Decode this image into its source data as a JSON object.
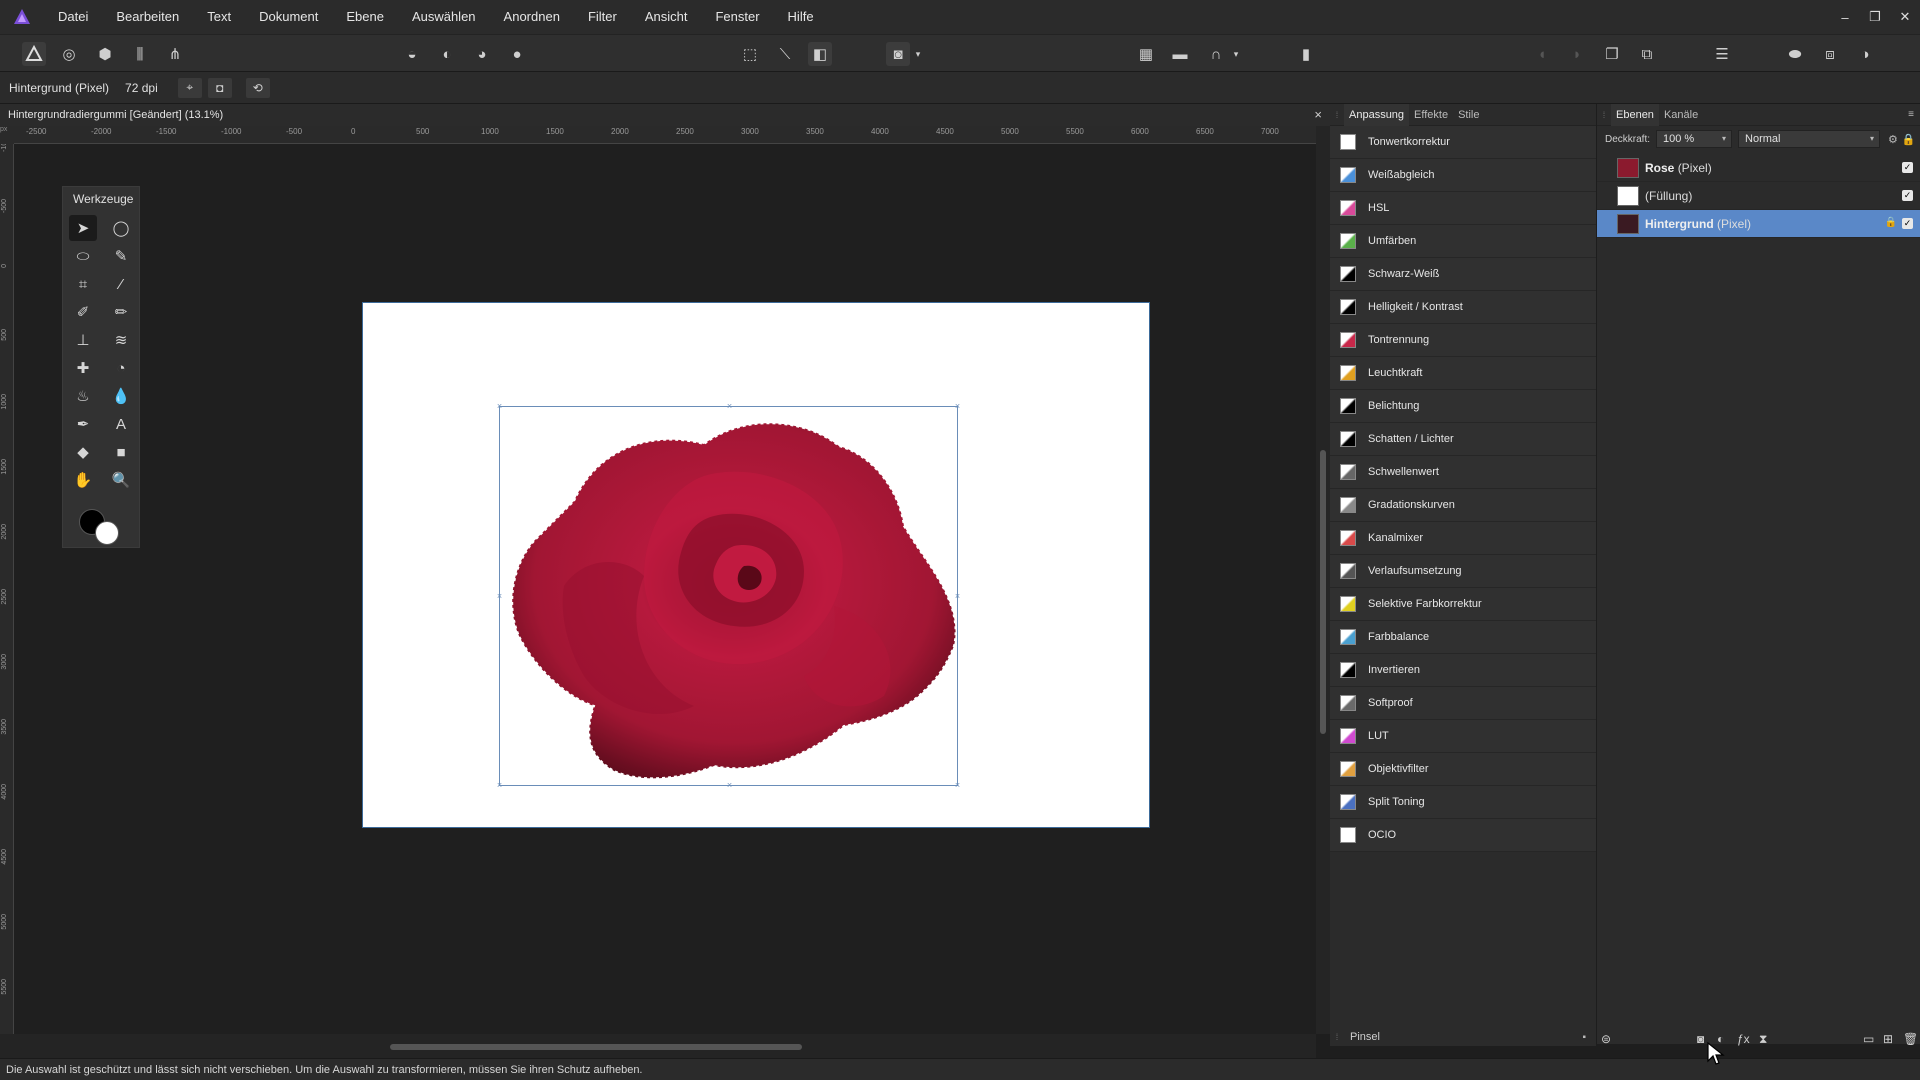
{
  "menubar": {
    "items": [
      "Datei",
      "Bearbeiten",
      "Text",
      "Dokument",
      "Ebene",
      "Auswählen",
      "Anordnen",
      "Filter",
      "Ansicht",
      "Fenster",
      "Hilfe"
    ],
    "window_controls": [
      "–",
      "❐",
      "✕"
    ]
  },
  "contextbar": {
    "layer_info": "Hintergrund (Pixel)",
    "dpi": "72 dpi"
  },
  "document": {
    "tab_title": "Hintergrundradiergummi [Geändert] (13.1%)",
    "close_label": "×"
  },
  "ruler": {
    "unit": "px",
    "top_ticks": [
      "-2500",
      "-2000",
      "-1500",
      "-1000",
      "-500",
      "0",
      "500",
      "1000",
      "1500",
      "2000",
      "2500",
      "3000",
      "3500",
      "4000",
      "4500",
      "5000",
      "5500",
      "6000",
      "6500",
      "7000"
    ],
    "left_ticks": [
      "-1000",
      "-500",
      "0",
      "500",
      "1000",
      "1500",
      "2000",
      "2500",
      "3000",
      "3500",
      "4000",
      "4500",
      "5000",
      "5500"
    ]
  },
  "tools": {
    "title": "Werkzeuge"
  },
  "adjustment_panel": {
    "tabs": [
      "Anpassung",
      "Effekte",
      "Stile"
    ],
    "active_tab": "Anpassung",
    "items": [
      {
        "label": "Tonwertkorrektur",
        "icon": "levels-icon",
        "color": "#ffffff"
      },
      {
        "label": "Weißabgleich",
        "icon": "white-balance-icon",
        "color": "#4a90d9"
      },
      {
        "label": "HSL",
        "icon": "hsl-icon",
        "color": "#d94a9a"
      },
      {
        "label": "Umfärben",
        "icon": "recolor-icon",
        "color": "#5ab04a"
      },
      {
        "label": "Schwarz-Weiß",
        "icon": "black-white-icon",
        "color": "#000000"
      },
      {
        "label": "Helligkeit / Kontrast",
        "icon": "brightness-contrast-icon",
        "color": "#000000"
      },
      {
        "label": "Tontrennung",
        "icon": "posterize-icon",
        "color": "#c8284a"
      },
      {
        "label": "Leuchtkraft",
        "icon": "vibrance-icon",
        "color": "#e0a020"
      },
      {
        "label": "Belichtung",
        "icon": "exposure-icon",
        "color": "#000000"
      },
      {
        "label": "Schatten / Lichter",
        "icon": "shadows-highlights-icon",
        "color": "#000000"
      },
      {
        "label": "Schwellenwert",
        "icon": "threshold-icon",
        "color": "#666666"
      },
      {
        "label": "Gradationskurven",
        "icon": "curves-icon",
        "color": "#888888"
      },
      {
        "label": "Kanalmixer",
        "icon": "channel-mixer-icon",
        "color": "#d94a4a"
      },
      {
        "label": "Verlaufsumsetzung",
        "icon": "gradient-map-icon",
        "color": "#555555"
      },
      {
        "label": "Selektive Farbkorrektur",
        "icon": "selective-color-icon",
        "color": "#e0d020"
      },
      {
        "label": "Farbbalance",
        "icon": "color-balance-icon",
        "color": "#4aa0d0"
      },
      {
        "label": "Invertieren",
        "icon": "invert-icon",
        "color": "#000000"
      },
      {
        "label": "Softproof",
        "icon": "soft-proof-icon",
        "color": "#6a6a6a"
      },
      {
        "label": "LUT",
        "icon": "lut-icon",
        "color": "#d04ad0"
      },
      {
        "label": "Objektivfilter",
        "icon": "lens-filter-icon",
        "color": "#e0a040"
      },
      {
        "label": "Split Toning",
        "icon": "split-toning-icon",
        "color": "#4a70c0"
      },
      {
        "label": "OCIO",
        "icon": "ocio-icon",
        "color": "#ffffff"
      }
    ],
    "footer_label": "Pinsel"
  },
  "layers_panel": {
    "tabs": [
      "Ebenen",
      "Kanäle"
    ],
    "active_tab": "Ebenen",
    "opacity_label": "Deckkraft:",
    "opacity_value": "100 %",
    "blend_mode": "Normal",
    "layers": [
      {
        "name": "Rose",
        "type": "(Pixel)",
        "thumb_color": "#8b1a2e",
        "selected": false,
        "locked": false
      },
      {
        "name": "",
        "type": "(Füllung)",
        "thumb_color": "#ffffff",
        "selected": false,
        "locked": false
      },
      {
        "name": "Hintergrund",
        "type": "(Pixel)",
        "thumb_color": "#3a1a22",
        "selected": true,
        "locked": true
      }
    ]
  },
  "statusbar": {
    "message": "Die Auswahl ist geschützt und lässt sich nicht verschieben. Um die Auswahl zu transformieren, müssen Sie ihren Schutz aufheben."
  },
  "colors": {
    "accent": "#5a88c8",
    "rose": "#a8122e",
    "canvas": "#1f1f1f"
  }
}
